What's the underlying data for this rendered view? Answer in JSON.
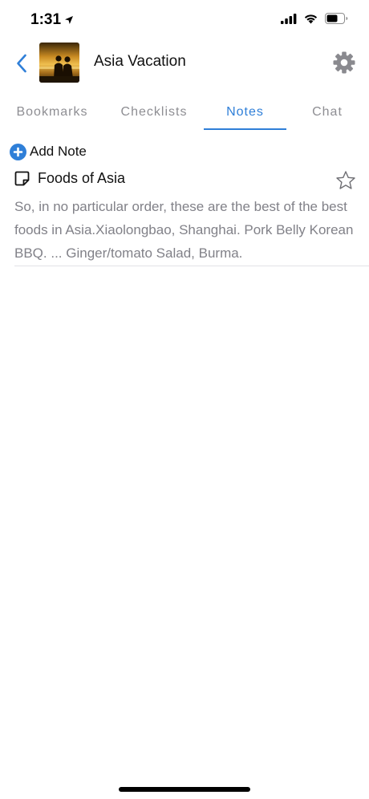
{
  "status_bar": {
    "time": "1:31"
  },
  "header": {
    "title": "Asia Vacation"
  },
  "tabs": [
    {
      "label": "Bookmarks",
      "active": false
    },
    {
      "label": "Checklists",
      "active": false
    },
    {
      "label": "Notes",
      "active": true
    },
    {
      "label": "Chat",
      "active": false
    }
  ],
  "add_note": {
    "label": "Add Note"
  },
  "notes": [
    {
      "title": "Foods of Asia",
      "preview": "So, in no particular order, these are the best of the best foods in Asia.Xiaolongbao, Shanghai. Pork Belly Korean BBQ. ... Ginger/tomato Salad, Burma.",
      "starred": false
    }
  ],
  "colors": {
    "accent": "#2f7fd8",
    "muted_text": "#818188",
    "tab_inactive": "#8e8e93"
  }
}
